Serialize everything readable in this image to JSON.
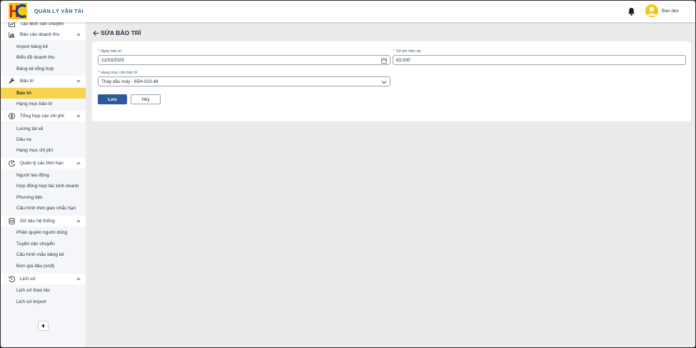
{
  "header": {
    "app_title": "QUẢN LÝ VẬN TẢI",
    "user_name": "Bao dev",
    "brand_color": "#2d5a9e",
    "avatar_color": "#f5c518"
  },
  "sidebar": {
    "active_color": "#f7d44c",
    "items": [
      {
        "type": "group",
        "label": "Tạo lệnh vận chuyển",
        "icon": "chart-line-icon",
        "chevron": false
      },
      {
        "type": "group",
        "label": "Báo cáo doanh thu",
        "icon": "bar-chart-icon",
        "chevron": true
      },
      {
        "type": "child",
        "label": "Import bảng kê"
      },
      {
        "type": "child",
        "label": "Biểu đồ doanh thu"
      },
      {
        "type": "child",
        "label": "Bảng kê tổng hợp"
      },
      {
        "type": "group",
        "label": "Bảo trì",
        "icon": "wrench-icon",
        "chevron": true
      },
      {
        "type": "child",
        "label": "Bảo trì",
        "active": true
      },
      {
        "type": "child",
        "label": "Hạng mục bảo trì"
      },
      {
        "type": "group",
        "label": "Tổng hợp các chi phí",
        "icon": "dollar-icon",
        "chevron": true
      },
      {
        "type": "child",
        "label": "Lương tài xế"
      },
      {
        "type": "child",
        "label": "Dầu xe"
      },
      {
        "type": "child",
        "label": "Hạng mục chi phí"
      },
      {
        "type": "group",
        "label": "Quản lý các thời hạn",
        "icon": "clock-icon",
        "chevron": true
      },
      {
        "type": "child",
        "label": "Người lao động"
      },
      {
        "type": "child",
        "label": "Hợp đồng hợp tác kinh doanh"
      },
      {
        "type": "child",
        "label": "Phương tiện"
      },
      {
        "type": "child",
        "label": "Cấu hình thời gian nhắc hạn"
      },
      {
        "type": "group",
        "label": "Dữ liệu hệ thống",
        "icon": "database-icon",
        "chevron": true
      },
      {
        "type": "child",
        "label": "Phân quyền người dùng"
      },
      {
        "type": "child",
        "label": "Tuyến vận chuyển"
      },
      {
        "type": "child",
        "label": "Cấu hình mẫu bảng kê"
      },
      {
        "type": "child",
        "label": "Đơn giá dầu (vnđ)"
      },
      {
        "type": "group",
        "label": "Lịch sử",
        "icon": "history-icon",
        "chevron": true
      },
      {
        "type": "child",
        "label": "Lịch sử thao tác"
      },
      {
        "type": "child",
        "label": "Lịch sử import"
      }
    ]
  },
  "page": {
    "title": "SỬA BẢO TRÌ"
  },
  "form": {
    "required_mark": "*",
    "date_label": "Ngày bảo trì",
    "date_value": "21/03/2025",
    "km_label": "Số km hiện tại",
    "km_value": "63,000",
    "category_label": "Hạng mục cần bảo trì",
    "category_value": "Thay dầu máy - 65H-023.48",
    "save_label": "Lưu",
    "cancel_label": "Hủy"
  }
}
